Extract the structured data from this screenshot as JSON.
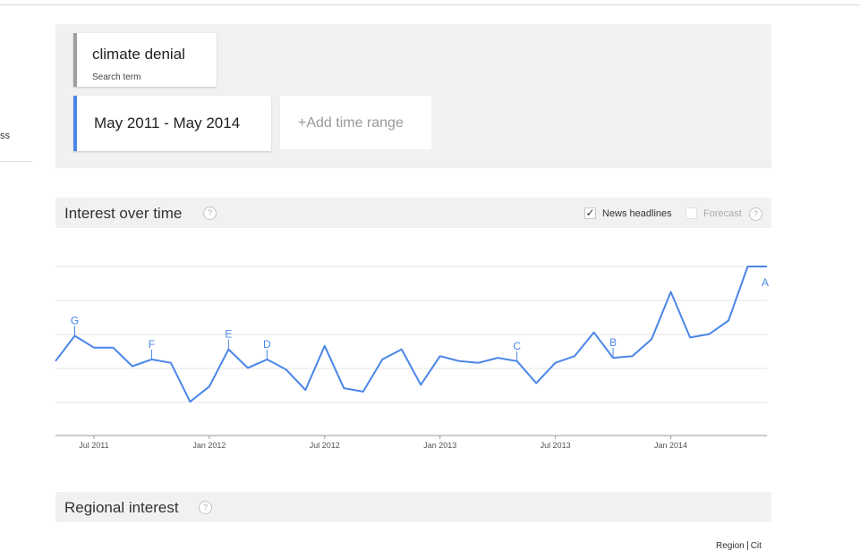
{
  "sidebar": {
    "cut_text": "ss"
  },
  "query": {
    "term": {
      "label": "climate denial",
      "sublabel": "Search term"
    },
    "time_range": {
      "label": "May 2011 - May 2014"
    },
    "add_time_range": {
      "label": "+Add time range"
    }
  },
  "interest_over_time": {
    "title": "Interest over time",
    "help": "?",
    "news_headlines": {
      "label": "News headlines",
      "checked": true,
      "check": "✓"
    },
    "forecast": {
      "label": "Forecast",
      "checked": false
    },
    "forecast_help": "?"
  },
  "chart_data": {
    "type": "line",
    "x": [
      "2011-05",
      "2011-06",
      "2011-07",
      "2011-08",
      "2011-09",
      "2011-10",
      "2011-11",
      "2011-12",
      "2012-01",
      "2012-02",
      "2012-03",
      "2012-04",
      "2012-05",
      "2012-06",
      "2012-07",
      "2012-08",
      "2012-09",
      "2012-10",
      "2012-11",
      "2012-12",
      "2013-01",
      "2013-02",
      "2013-03",
      "2013-04",
      "2013-05",
      "2013-06",
      "2013-07",
      "2013-08",
      "2013-09",
      "2013-10",
      "2013-11",
      "2013-12",
      "2014-01",
      "2014-02",
      "2014-03",
      "2014-04",
      "2014-05",
      "2014-06"
    ],
    "series": [
      {
        "values": [
          44,
          59,
          52,
          52,
          41,
          45,
          43,
          20,
          29,
          51,
          40,
          45,
          39,
          27,
          53,
          28,
          26,
          45,
          51,
          30,
          47,
          44,
          43,
          46,
          44,
          31,
          43,
          47,
          61,
          46,
          47,
          57,
          85,
          58,
          60,
          68,
          100,
          100
        ]
      }
    ],
    "color": "#4a86e8",
    "x_tick_labels": [
      {
        "label": "Jul 2011",
        "at": "2011-07"
      },
      {
        "label": "Jan 2012",
        "at": "2012-01"
      },
      {
        "label": "Jul 2012",
        "at": "2012-07"
      },
      {
        "label": "Jan 2013",
        "at": "2013-01"
      },
      {
        "label": "Jul 2013",
        "at": "2013-07"
      },
      {
        "label": "Jan 2014",
        "at": "2014-01"
      }
    ],
    "annotations": [
      {
        "label": "G",
        "at": "2011-06"
      },
      {
        "label": "F",
        "at": "2011-10"
      },
      {
        "label": "E",
        "at": "2012-02"
      },
      {
        "label": "D",
        "at": "2012-04"
      },
      {
        "label": "C",
        "at": "2013-05"
      },
      {
        "label": "B",
        "at": "2013-10"
      },
      {
        "label": "A",
        "at": "2014-06"
      }
    ],
    "ylim": [
      0,
      100
    ],
    "grid": true,
    "legend": "none"
  },
  "regional_interest": {
    "title": "Regional interest",
    "help": "?"
  },
  "footer": {
    "cut_left": "Region",
    "cut_right": "Cit"
  }
}
